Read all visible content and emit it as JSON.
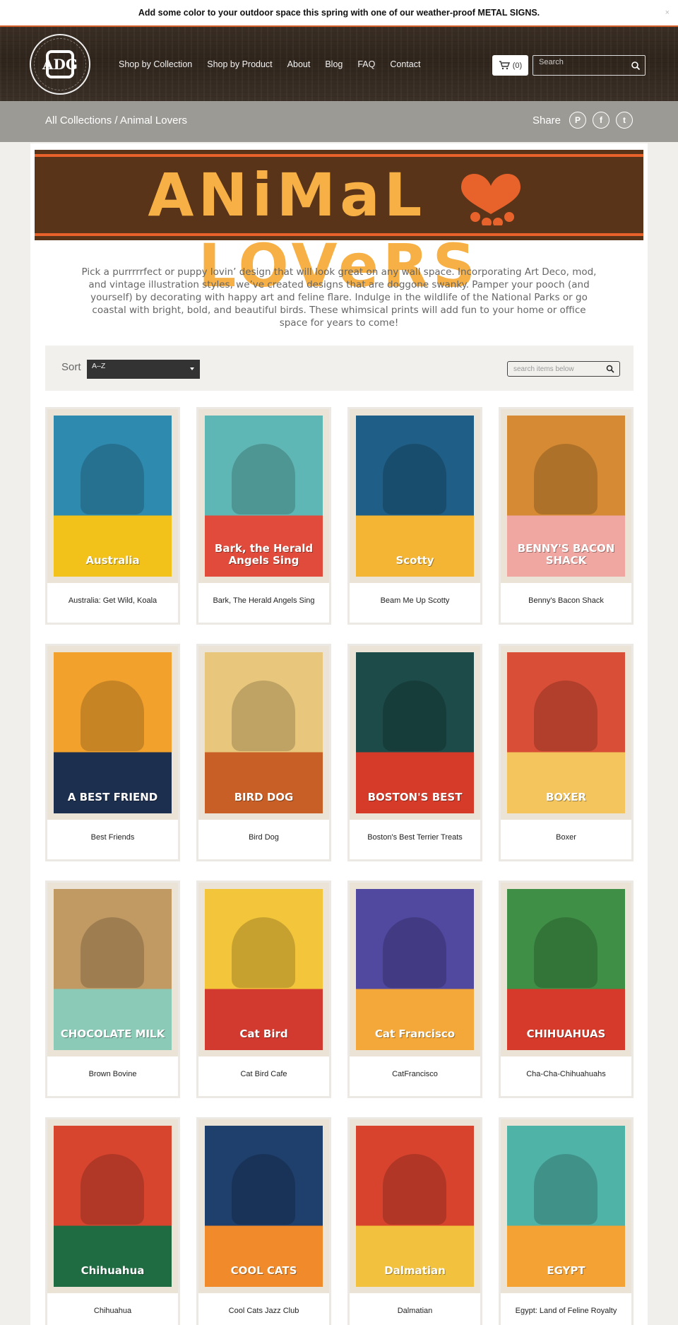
{
  "announcement": {
    "text": "Add some color to your outdoor space this spring with one of our weather-proof METAL SIGNS.",
    "close": "×"
  },
  "header": {
    "logo_text": "Anderson Design Group ADGSTORE.COM",
    "logo_mark": "ADG",
    "nav": [
      "Shop by Collection",
      "Shop by Product",
      "About",
      "Blog",
      "FAQ",
      "Contact"
    ],
    "cart_count": "(0)",
    "search_placeholder": "Search"
  },
  "breadcrumb": {
    "root": "All Collections",
    "separator": " / ",
    "current": "Animal Lovers",
    "share_label": "Share",
    "share_buttons": [
      "pinterest-icon",
      "facebook-icon",
      "twitter-icon"
    ]
  },
  "banner": {
    "left": "ANiMaL",
    "right": "LOVeRS"
  },
  "intro": "Pick a purrrrrfect or puppy lovin’ design that will look great on any wall space. Incorporating Art Deco, mod, and vintage illustration styles, we’ve created designs that are doggone swanky. Pamper your pooch (and yourself) by decorating with happy art and feline flare. Indulge in the wildlife of the National Parks or go coastal with bright, bold, and beautiful birds. These whimsical prints will add fun to your home or office space for years to come!",
  "toolbar": {
    "sort_label": "Sort",
    "sort_value": "A–Z",
    "filter_placeholder": "search items below"
  },
  "products": [
    {
      "title": "Australia: Get Wild, Koala",
      "poster_text": "Australia",
      "bg": "#2f8ab0",
      "accent": "#f2c21a"
    },
    {
      "title": "Bark, The Herald Angels Sing",
      "poster_text": "Bark, the Herald Angels Sing",
      "bg": "#5fb7b5",
      "accent": "#e04b3b"
    },
    {
      "title": "Beam Me Up Scotty",
      "poster_text": "Scotty",
      "bg": "#1f5e86",
      "accent": "#f4b534"
    },
    {
      "title": "Benny's Bacon Shack",
      "poster_text": "BENNY'S BACON SHACK",
      "bg": "#d58a33",
      "accent": "#f0a7a1"
    },
    {
      "title": "Best Friends",
      "poster_text": "A BEST FRIEND",
      "bg": "#f2a12c",
      "accent": "#1c2f4f"
    },
    {
      "title": "Bird Dog",
      "poster_text": "BIRD DOG",
      "bg": "#e8c77c",
      "accent": "#c75f26"
    },
    {
      "title": "Boston's Best Terrier Treats",
      "poster_text": "BOSTON'S BEST",
      "bg": "#1d4b49",
      "accent": "#d63b2a"
    },
    {
      "title": "Boxer",
      "poster_text": "BOXER",
      "bg": "#d94e36",
      "accent": "#f3c55c"
    },
    {
      "title": "Brown Bovine",
      "poster_text": "CHOCOLATE MILK",
      "bg": "#c19a63",
      "accent": "#8ccab8"
    },
    {
      "title": "Cat Bird Cafe",
      "poster_text": "Cat Bird",
      "bg": "#f2c53a",
      "accent": "#d23a2f"
    },
    {
      "title": "CatFrancisco",
      "poster_text": "Cat Francisco",
      "bg": "#5149a0",
      "accent": "#f4a83a"
    },
    {
      "title": "Cha-Cha-Chihuahuahs",
      "poster_text": "CHIHUAHUAS",
      "bg": "#3f8f46",
      "accent": "#d53a2a"
    },
    {
      "title": "Chihuahua",
      "poster_text": "Chihuahua",
      "bg": "#d8452f",
      "accent": "#1f6b42"
    },
    {
      "title": "Cool Cats Jazz Club",
      "poster_text": "COOL CATS",
      "bg": "#1f3f6c",
      "accent": "#f08a2a"
    },
    {
      "title": "Dalmatian",
      "poster_text": "Dalmatian",
      "bg": "#d8432e",
      "accent": "#f2c23e"
    },
    {
      "title": "Egypt: Land of Feline Royalty",
      "poster_text": "EGYPT",
      "bg": "#4fb3a8",
      "accent": "#f4a234"
    }
  ]
}
